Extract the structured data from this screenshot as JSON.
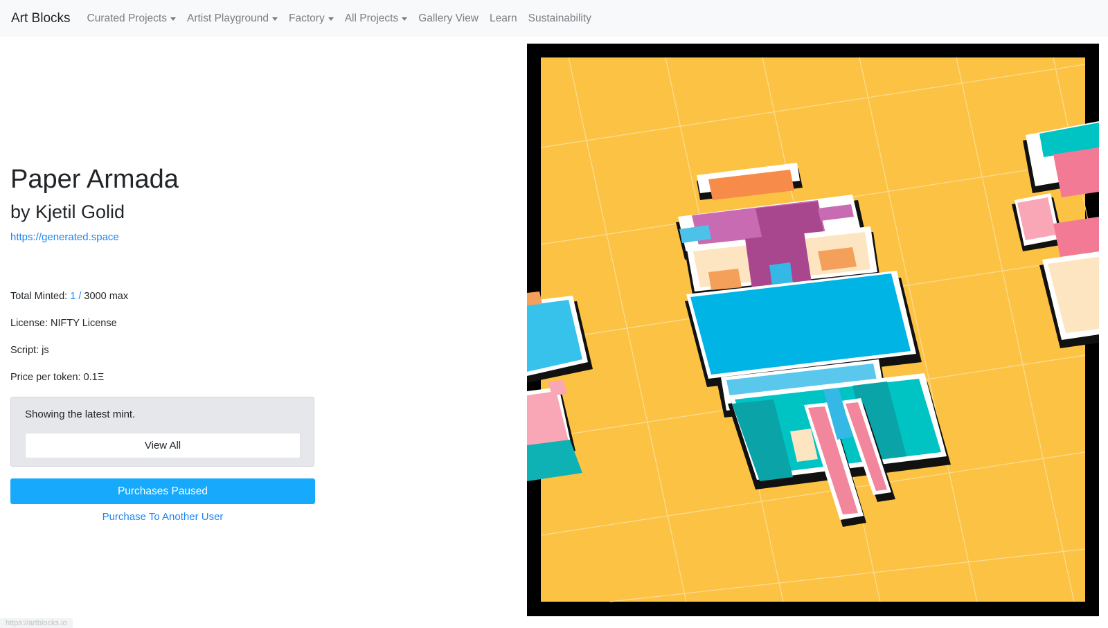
{
  "nav": {
    "brand": "Art Blocks",
    "items": [
      {
        "label": "Curated Projects",
        "dropdown": true
      },
      {
        "label": "Artist Playground",
        "dropdown": true
      },
      {
        "label": "Factory",
        "dropdown": true
      },
      {
        "label": "All Projects",
        "dropdown": true
      },
      {
        "label": "Gallery View",
        "dropdown": false
      },
      {
        "label": "Learn",
        "dropdown": false
      },
      {
        "label": "Sustainability",
        "dropdown": false
      }
    ]
  },
  "project": {
    "title": "Paper Armada",
    "artist": "by Kjetil Golid",
    "website": "https://generated.space",
    "total_minted_label": "Total Minted:",
    "minted": "1",
    "minted_sep": "/",
    "max": "3000 max",
    "license_label": "License:",
    "license": "NIFTY License",
    "script_label": "Script:",
    "script": "js",
    "price_label": "Price per token:",
    "price": "0.1Ξ"
  },
  "latest": {
    "text": "Showing the latest mint.",
    "view_all_label": "View All"
  },
  "actions": {
    "paused_label": "Purchases Paused",
    "purchase_other_label": "Purchase To Another User"
  },
  "status_bar": {
    "url": "https://artblocks.io"
  },
  "colors": {
    "accent": "#17a9fc",
    "link": "#1a86f4",
    "artwork_bg": "#fcc244"
  }
}
